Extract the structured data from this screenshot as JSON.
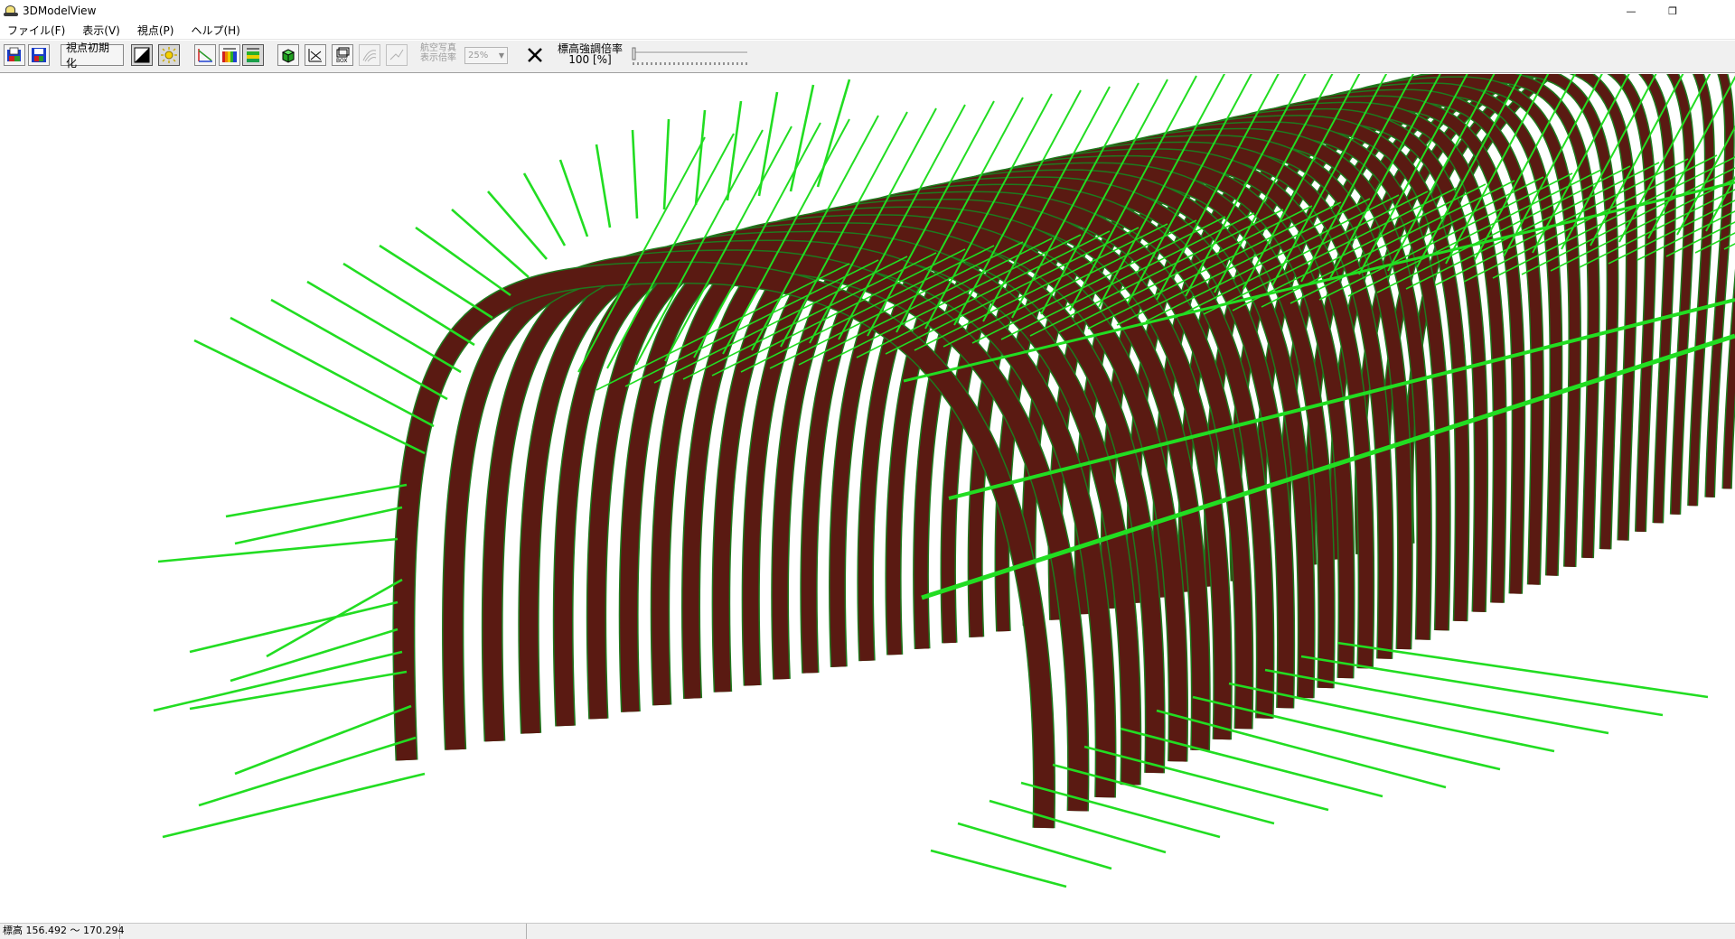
{
  "window": {
    "title": "3DModelView",
    "minimize_glyph": "—",
    "restore_glyph": "❐",
    "close_glyph": ""
  },
  "menu": {
    "items": [
      "ファイル(F)",
      "表示(V)",
      "視点(P)",
      "ヘルプ(H)"
    ]
  },
  "toolbar": {
    "reset_view_label": "視点初期化",
    "aerial_photo_label_1": "航空写真",
    "aerial_photo_label_2": "表示倍率",
    "aerial_scale_value": "25%",
    "height_emphasis_label": "標高強調倍率",
    "height_emphasis_value": "100 [%]",
    "icons": [
      "open-file-icon",
      "save-file-icon",
      "reset-view-button",
      "contrast-icon",
      "light-icon",
      "slope-icon",
      "color-scale-icon",
      "color-legend-icon",
      "solid-model-icon",
      "section-icon",
      "box-icon",
      "contour-icon",
      "line-icon",
      "close-x-icon"
    ]
  },
  "status": {
    "elevation_range": "標高 156.492 〜 170.294",
    "pane2": "",
    "pane3": ""
  },
  "colors": {
    "arch_fill": "#5a1a12",
    "arch_edge": "#1e7a1e",
    "bolt": "#22dd22",
    "toolbar_bg": "#f0f0f0"
  }
}
